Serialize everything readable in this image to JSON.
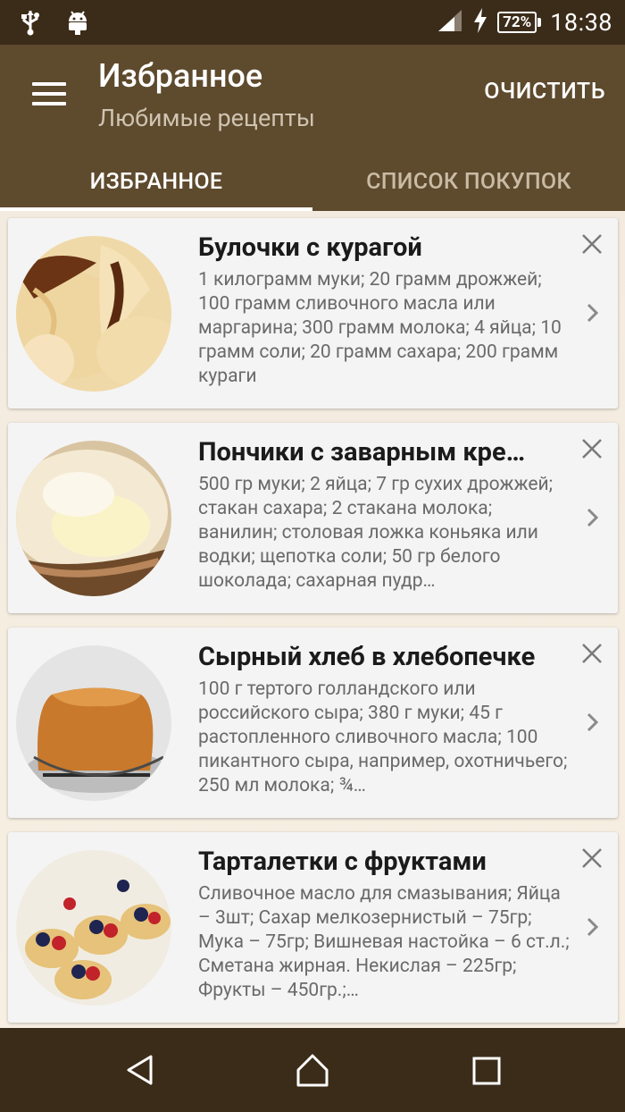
{
  "status_bar": {
    "time": "18:38",
    "battery": "72%",
    "left_icons": [
      "usb-icon",
      "android-icon"
    ],
    "right_icons": [
      "signal-icon",
      "charging-icon",
      "battery-icon"
    ]
  },
  "app_bar": {
    "title": "Избранное",
    "subtitle": "Любимые рецепты",
    "menu_icon": "hamburger-icon",
    "clear_label": "ОЧИСТИТЬ"
  },
  "tabs": [
    {
      "label": "ИЗБРАННОЕ",
      "active": true
    },
    {
      "label": "СПИСОК ПОКУПОК",
      "active": false
    }
  ],
  "recipes": [
    {
      "title": "Булочки с курагой",
      "description": "1 килограмм муки; 20 грамм дрожжей; 100 грамм сливочного масла или маргарина; 300 грамм молока; 4 яйца; 10 грамм соли; 20 грамм сахара; 200 грамм кураги"
    },
    {
      "title": "Пончики с заварным кре…",
      "description": "500 гр муки; 2 яйца; 7 гр сухих дрожжей; стакан сахара; 2 стакана молока; ванилин; столовая ложка коньяка или водки; щепотка соли; 50 гр белого шоколада; сахарная пудр…"
    },
    {
      "title": "Сырный хлеб в хлебопечке",
      "description": "100 г тертого голландского или российского сыра; 380 г муки; 45 г растопленного сливочного масла; 100 пикантного сыра, например, охотничьего; 250 мл молока; ¾…"
    },
    {
      "title": "Тарталетки с фруктами",
      "description": "Сливочное масло для смазывания; Яйца – 3шт; Сахар мелкозернистый – 75гр; Мука – 75гр; Вишневая настойка – 6 ст.л.; Сметана жирная. Некислая – 225гр; Фрукты – 450гр.;…"
    }
  ],
  "nav_bar": [
    "back-icon",
    "home-icon",
    "recents-icon"
  ],
  "colors": {
    "status_bar": "#3b2c19",
    "app_bar": "#5e4a2d",
    "list_background": "#f6efe4",
    "card": "#f4f4f4"
  }
}
